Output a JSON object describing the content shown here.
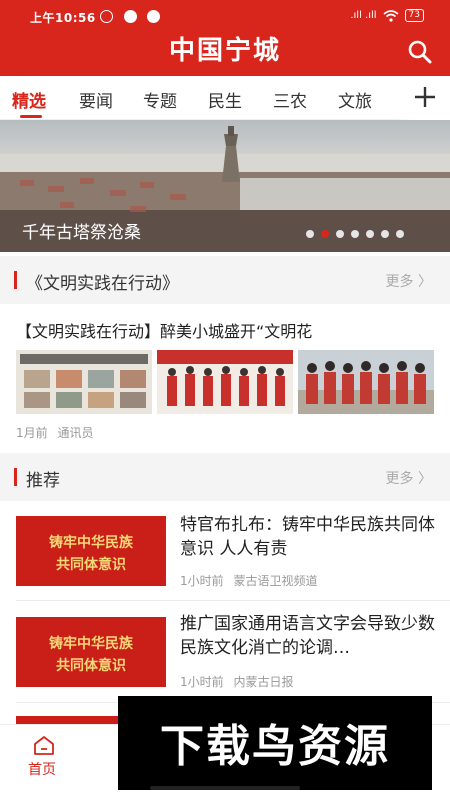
{
  "status_bar": {
    "time": "上午10:56",
    "signal": ".ıll .ıll",
    "battery": "73"
  },
  "header": {
    "title": "中国宁城"
  },
  "tabs": [
    {
      "label": "精选"
    },
    {
      "label": "要闻"
    },
    {
      "label": "专题"
    },
    {
      "label": "民生"
    },
    {
      "label": "三农"
    },
    {
      "label": "文旅"
    }
  ],
  "banner": {
    "caption": "千年古塔祭沧桑",
    "dots_total": 7,
    "active_dot": 2
  },
  "section_culture": {
    "title": "《文明实践在行动》",
    "more": "更多 〉",
    "article": {
      "title": "【文明实践在行动】醉美小城盛开“文明花",
      "time": "1月前",
      "source": "通讯员"
    }
  },
  "section_recommend": {
    "title": "推荐",
    "more": "更多 〉",
    "items": [
      {
        "image_text_1": "铸牢中华民族",
        "image_text_2": "共同体意识",
        "title": "特官布扎布：铸牢中华民族共同体意识 人人有责",
        "time": "1小时前",
        "source": "蒙古语卫视频道"
      },
      {
        "image_text_1": "铸牢中华民族",
        "image_text_2": "共同体意识",
        "title": "推广国家通用语言文字会导致少数民族文化消亡的论调…",
        "time": "1小时前",
        "source": "内蒙古日报"
      }
    ]
  },
  "bottom_nav": {
    "home_label": "首页"
  },
  "watermark": {
    "text": "下载鸟资源"
  },
  "colors": {
    "brand_red": "#d8261c"
  }
}
